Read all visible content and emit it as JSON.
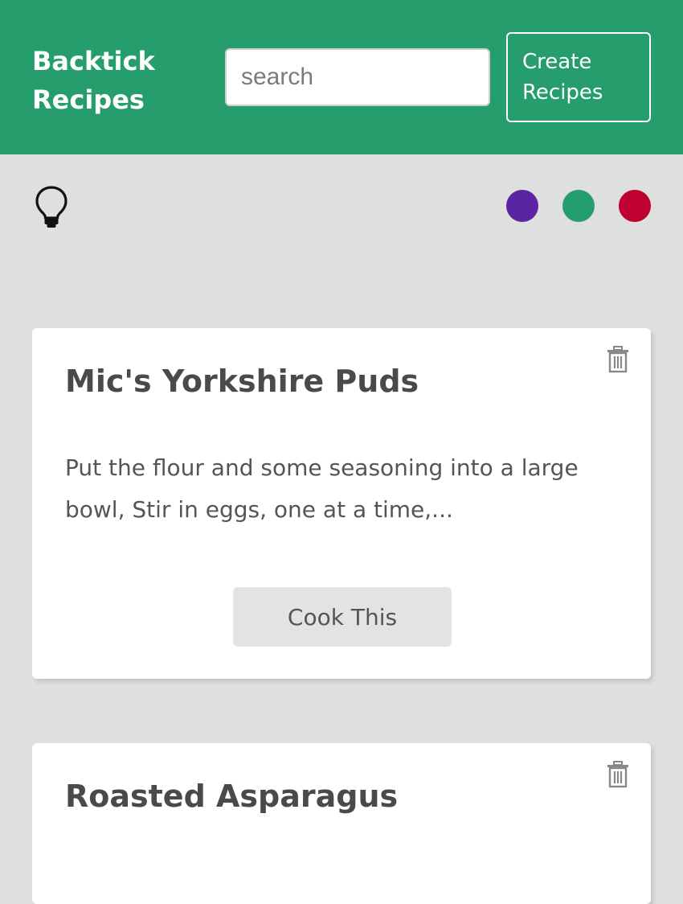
{
  "header": {
    "brand_line1": "Backtick",
    "brand_line2": "Recipes",
    "search_placeholder": "search",
    "create_line1": "Create",
    "create_line2": "Recipes",
    "background_color": "#259d6d"
  },
  "toolbar": {
    "theme_icon": "lightbulb-icon",
    "swatches": [
      {
        "name": "purple",
        "color": "#5b24a0"
      },
      {
        "name": "green",
        "color": "#259d6d"
      },
      {
        "name": "red",
        "color": "#c0002f"
      }
    ]
  },
  "recipes": [
    {
      "title": "Mic's Yorkshire Puds",
      "description": "Put the flour and some seasoning into a large bowl, Stir in eggs, one at a time,...",
      "action_label": "Cook This",
      "delete_icon": "trash-icon"
    },
    {
      "title": "Roasted Asparagus",
      "delete_icon": "trash-icon"
    }
  ]
}
